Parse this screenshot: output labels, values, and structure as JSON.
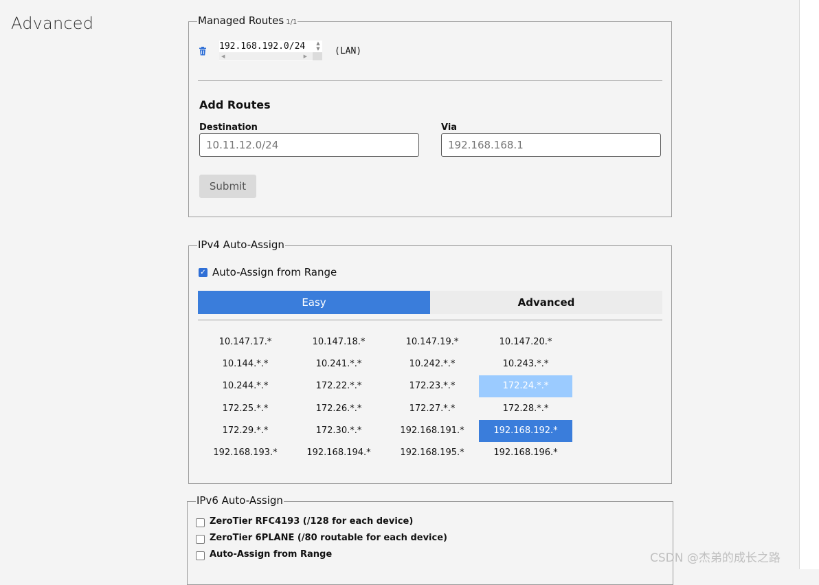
{
  "page": {
    "title": "Advanced"
  },
  "managed_routes": {
    "legend": "Managed Routes",
    "count": "1/1",
    "routes": [
      {
        "target": "192.168.192.0/24",
        "via": "(LAN)"
      }
    ],
    "add_routes": {
      "title": "Add Routes",
      "destination_label": "Destination",
      "destination_placeholder": "10.11.12.0/24",
      "via_label": "Via",
      "via_placeholder": "192.168.168.1",
      "submit_label": "Submit"
    }
  },
  "ipv4": {
    "legend": "IPv4 Auto-Assign",
    "auto_assign_label": "Auto-Assign from Range",
    "auto_assign_checked": true,
    "tabs": {
      "easy": "Easy",
      "advanced": "Advanced",
      "active": "easy"
    },
    "ranges": [
      [
        "10.147.17.*",
        "10.147.18.*",
        "10.147.19.*",
        "10.147.20.*"
      ],
      [
        "10.144.*.*",
        "10.241.*.*",
        "10.242.*.*",
        "10.243.*.*"
      ],
      [
        "10.244.*.*",
        "172.22.*.*",
        "172.23.*.*",
        "172.24.*.*"
      ],
      [
        "172.25.*.*",
        "172.26.*.*",
        "172.27.*.*",
        "172.28.*.*"
      ],
      [
        "172.29.*.*",
        "172.30.*.*",
        "192.168.191.*",
        "192.168.192.*"
      ],
      [
        "192.168.193.*",
        "192.168.194.*",
        "192.168.195.*",
        "192.168.196.*"
      ]
    ],
    "hovered_range": "172.24.*.*",
    "selected_range": "192.168.192.*"
  },
  "ipv6": {
    "legend": "IPv6 Auto-Assign",
    "options": [
      {
        "label": "ZeroTier RFC4193 (/128 for each device)",
        "checked": false
      },
      {
        "label": "ZeroTier 6PLANE (/80 routable for each device)",
        "checked": false
      },
      {
        "label": "Auto-Assign from Range",
        "checked": false
      }
    ]
  },
  "watermark": "CSDN @杰弟的成长之路",
  "colors": {
    "accent": "#3a7ddb",
    "hover": "#9bcbff",
    "background": "#f4f4f4"
  }
}
